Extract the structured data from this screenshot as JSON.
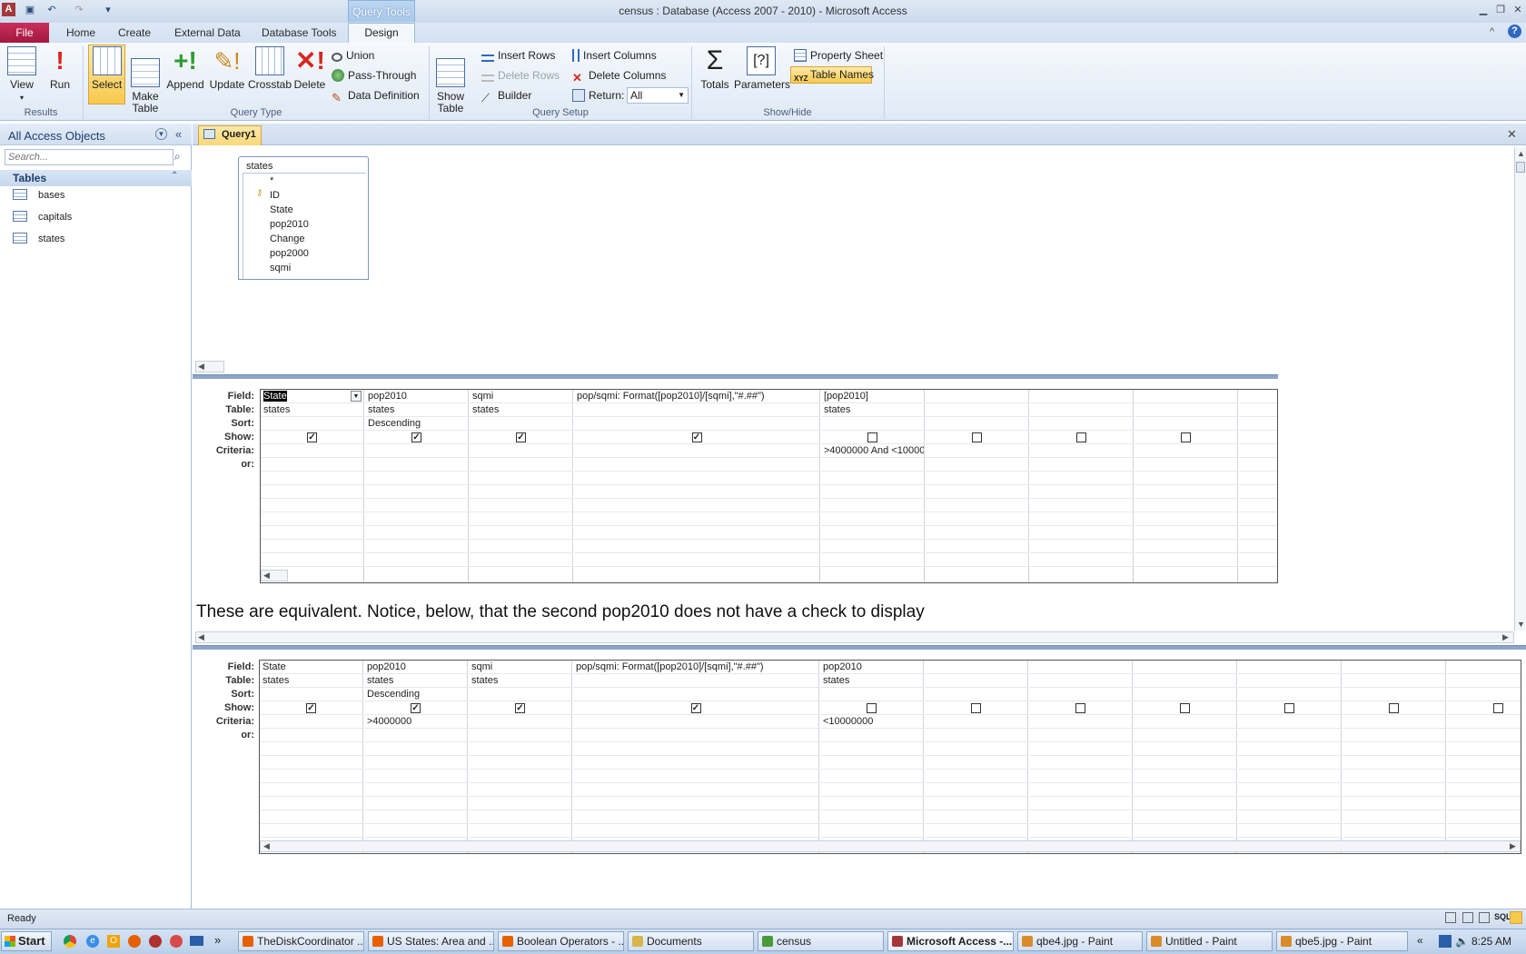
{
  "window": {
    "title": "census : Database (Access 2007 - 2010)  -  Microsoft Access",
    "context_tab": "Query Tools"
  },
  "ribbon": {
    "tabs": [
      "File",
      "Home",
      "Create",
      "External Data",
      "Database Tools",
      "Design"
    ],
    "results": {
      "label": "Results",
      "view": "View",
      "run": "Run"
    },
    "query_type": {
      "label": "Query Type",
      "select": "Select",
      "make_table": "Make\nTable",
      "append": "Append",
      "update": "Update",
      "crosstab": "Crosstab",
      "delete": "Delete",
      "union": "Union",
      "pass_through": "Pass-Through",
      "data_definition": "Data Definition"
    },
    "query_setup": {
      "label": "Query Setup",
      "show_table": "Show\nTable",
      "insert_rows": "Insert Rows",
      "delete_rows": "Delete Rows",
      "builder": "Builder",
      "insert_columns": "Insert Columns",
      "delete_columns": "Delete Columns",
      "return_label": "Return:",
      "return_value": "All"
    },
    "show_hide": {
      "label": "Show/Hide",
      "totals": "Totals",
      "parameters": "Parameters",
      "property_sheet": "Property Sheet",
      "table_names": "Table Names"
    }
  },
  "nav": {
    "title": "All Access Objects",
    "search_placeholder": "Search...",
    "section": "Tables",
    "items": [
      "bases",
      "capitals",
      "states"
    ]
  },
  "document": {
    "tab": "Query1",
    "table_window": {
      "name": "states",
      "fields": [
        "*",
        "ID",
        "State",
        "pop2010",
        "Change",
        "pop2000",
        "sqmi"
      ]
    }
  },
  "grid_labels": [
    "Field:",
    "Table:",
    "Sort:",
    "Show:",
    "Criteria:",
    "or:"
  ],
  "grid1": {
    "columns": [
      {
        "field": "State",
        "table": "states",
        "sort": "",
        "show": true,
        "criteria": ""
      },
      {
        "field": "pop2010",
        "table": "states",
        "sort": "Descending",
        "show": true,
        "criteria": ""
      },
      {
        "field": "sqmi",
        "table": "states",
        "sort": "",
        "show": true,
        "criteria": ""
      },
      {
        "field": "pop/sqmi: Format([pop2010]/[sqmi],\"#.##\")",
        "table": "",
        "sort": "",
        "show": true,
        "criteria": ""
      },
      {
        "field": "[pop2010]",
        "table": "states",
        "sort": "",
        "show": false,
        "criteria": ">4000000 And <10000"
      },
      {
        "field": "",
        "table": "",
        "sort": "",
        "show": false,
        "criteria": ""
      },
      {
        "field": "",
        "table": "",
        "sort": "",
        "show": false,
        "criteria": ""
      },
      {
        "field": "",
        "table": "",
        "sort": "",
        "show": false,
        "criteria": ""
      },
      {
        "field": "",
        "table": "",
        "sort": "",
        "show": null,
        "criteria": ""
      }
    ]
  },
  "note": "These are equivalent. Notice, below, that the second pop2010 does not have a check to display",
  "grid2": {
    "columns": [
      {
        "field": "State",
        "table": "states",
        "sort": "",
        "show": true,
        "criteria": ""
      },
      {
        "field": "pop2010",
        "table": "states",
        "sort": "Descending",
        "show": true,
        "criteria": ">4000000"
      },
      {
        "field": "sqmi",
        "table": "states",
        "sort": "",
        "show": true,
        "criteria": ""
      },
      {
        "field": "pop/sqmi: Format([pop2010]/[sqmi],\"#.##\")",
        "table": "",
        "sort": "",
        "show": true,
        "criteria": ""
      },
      {
        "field": "pop2010",
        "table": "states",
        "sort": "",
        "show": false,
        "criteria": "<10000000"
      },
      {
        "field": "",
        "table": "",
        "sort": "",
        "show": false,
        "criteria": ""
      },
      {
        "field": "",
        "table": "",
        "sort": "",
        "show": false,
        "criteria": ""
      },
      {
        "field": "",
        "table": "",
        "sort": "",
        "show": false,
        "criteria": ""
      },
      {
        "field": "",
        "table": "",
        "sort": "",
        "show": false,
        "criteria": ""
      },
      {
        "field": "",
        "table": "",
        "sort": "",
        "show": false,
        "criteria": ""
      },
      {
        "field": "",
        "table": "",
        "sort": "",
        "show": false,
        "criteria": ""
      }
    ]
  },
  "status": {
    "text": "Ready"
  },
  "taskbar": {
    "start": "Start",
    "items": [
      "TheDiskCoordinator ...",
      "US States: Area and ...",
      "Boolean Operators - ...",
      "Documents",
      "census",
      "Microsoft Access -...",
      "qbe4.jpg - Paint",
      "Untitled - Paint",
      "qbe5.jpg - Paint"
    ],
    "active": 5,
    "clock": "8:25 AM"
  },
  "colors": {
    "accent": "#a4373a",
    "ribbon_highlight": "#f7c94d",
    "file_tab": "#b8234c"
  }
}
